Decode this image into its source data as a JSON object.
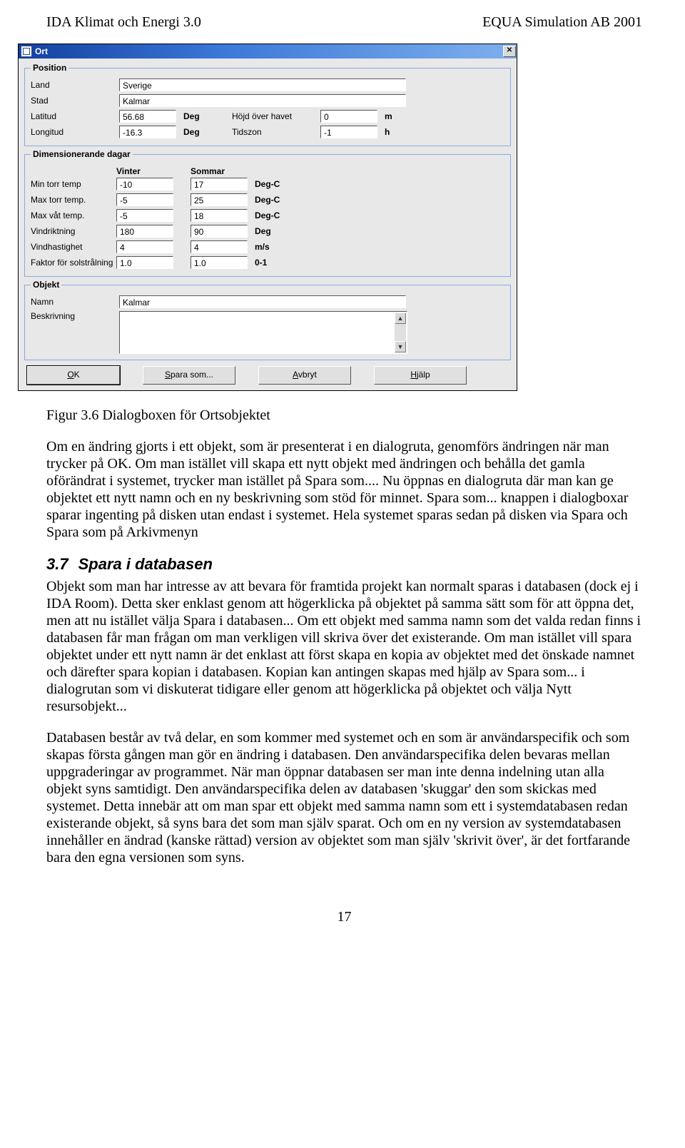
{
  "header": {
    "left": "IDA Klimat och Energi 3.0",
    "right": "EQUA Simulation AB 2001"
  },
  "dialog": {
    "title": "Ort",
    "close_glyph": "✕",
    "buttons": {
      "ok": "OK",
      "saveas": "Spara som...",
      "cancel": "Avbryt",
      "help": "Hjälp"
    },
    "position": {
      "legend": "Position",
      "land_label": "Land",
      "land_value": "Sverige",
      "stad_label": "Stad",
      "stad_value": "Kalmar",
      "lat_label": "Latitud",
      "lat_value": "56.68",
      "lat_unit": "Deg",
      "height_label": "Höjd över havet",
      "height_value": "0",
      "height_unit": "m",
      "lon_label": "Longitud",
      "lon_value": "-16.3",
      "lon_unit": "Deg",
      "tz_label": "Tidszon",
      "tz_value": "-1",
      "tz_unit": "h"
    },
    "design": {
      "legend": "Dimensionerande dagar",
      "col_winter": "Vinter",
      "col_summer": "Sommar",
      "rows": [
        {
          "label": "Min torr temp",
          "w": "-10",
          "s": "17",
          "u": "Deg-C"
        },
        {
          "label": "Max torr temp.",
          "w": "-5",
          "s": "25",
          "u": "Deg-C"
        },
        {
          "label": "Max våt temp.",
          "w": "-5",
          "s": "18",
          "u": "Deg-C"
        },
        {
          "label": "Vindriktning",
          "w": "180",
          "s": "90",
          "u": "Deg"
        },
        {
          "label": "Vindhastighet",
          "w": "4",
          "s": "4",
          "u": "m/s"
        },
        {
          "label": "Faktor för solstrålning",
          "w": "1.0",
          "s": "1.0",
          "u": "0-1"
        }
      ]
    },
    "object": {
      "legend": "Objekt",
      "name_label": "Namn",
      "name_value": "Kalmar",
      "desc_label": "Beskrivning",
      "desc_value": ""
    }
  },
  "caption": "Figur 3.6 Dialogboxen för Ortsobjektet",
  "para1": "Om en ändring gjorts i ett objekt, som är presenterat i en dialogruta, genomförs ändringen när man trycker på OK. Om man istället vill skapa ett nytt objekt med ändringen och behålla det gamla oförändrat i systemet, trycker man istället på Spara som.... Nu öppnas en dialogruta där man kan ge objektet ett nytt namn och en ny beskrivning som stöd för minnet. Spara som... knappen i dialogboxar sparar ingenting på disken utan endast i systemet. Hela systemet sparas sedan på disken via Spara och Spara som på Arkivmenyn",
  "section": {
    "num": "3.7",
    "title": "Spara i databasen"
  },
  "para2": "Objekt som man har intresse av att bevara för framtida projekt kan normalt sparas i databasen (dock ej i IDA Room). Detta sker enklast genom att högerklicka på objektet på samma sätt som för att öppna det, men att nu istället välja Spara i databasen... Om ett objekt med samma namn som det valda redan finns i databasen får man frågan om man verkligen vill skriva över det existerande. Om man istället vill spara objektet under ett nytt namn är det enklast att först skapa en kopia av objektet med det önskade namnet och därefter spara kopian i databasen. Kopian kan antingen skapas med hjälp av Spara som... i dialogrutan som vi diskuterat tidigare eller genom att högerklicka på objektet och välja Nytt resursobjekt...",
  "para3": "Databasen består av två delar, en som kommer med systemet och en som är användarspecifik och som skapas första gången man gör en ändring i databasen. Den användarspecifika delen bevaras mellan uppgraderingar av programmet. När man öppnar databasen ser man inte denna indelning utan alla objekt syns samtidigt. Den användarspecifika delen av databasen 'skuggar' den som skickas med systemet. Detta innebär att om man spar ett objekt med samma namn som ett i systemdatabasen redan existerande objekt, så syns bara det som man själv sparat. Och om en ny version av systemdatabasen innehåller en ändrad (kanske rättad) version av objektet som man själv 'skrivit över', är det fortfarande bara den egna versionen som syns.",
  "page_number": "17"
}
